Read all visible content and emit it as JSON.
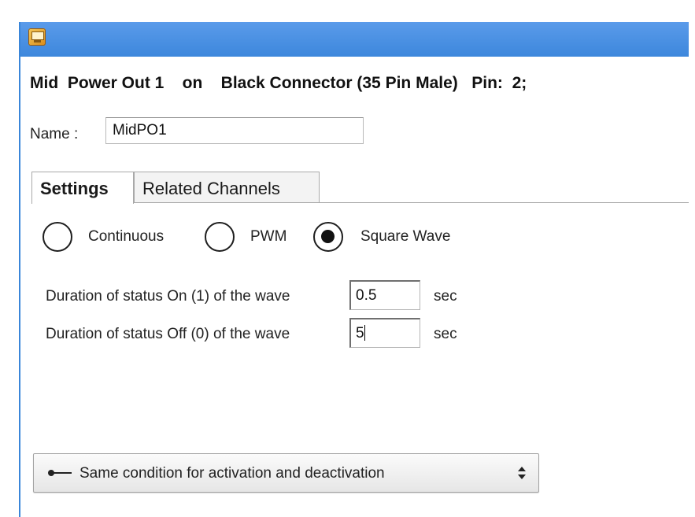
{
  "window": {
    "heading": "Mid  Power Out 1    on    Black Connector (35 Pin Male)   Pin:  2;",
    "icon": "app-monitor-icon",
    "accent_color": "#4a90e2"
  },
  "name": {
    "label": "Name :",
    "value": "MidPO1"
  },
  "tabs": [
    {
      "label": "Settings",
      "active": true
    },
    {
      "label": "Related Channels",
      "active": false
    }
  ],
  "modes": [
    {
      "label": "Continuous",
      "selected": false
    },
    {
      "label": "PWM",
      "selected": false
    },
    {
      "label": "Square Wave",
      "selected": true
    }
  ],
  "wave": {
    "on_label": "Duration of status On (1) of the wave",
    "on_value": "0.5",
    "off_label": "Duration of status Off (0) of the wave",
    "off_value": "5",
    "unit": "sec"
  },
  "condition": {
    "selected": "Same condition for activation and deactivation",
    "icon": "line-connector-icon"
  }
}
